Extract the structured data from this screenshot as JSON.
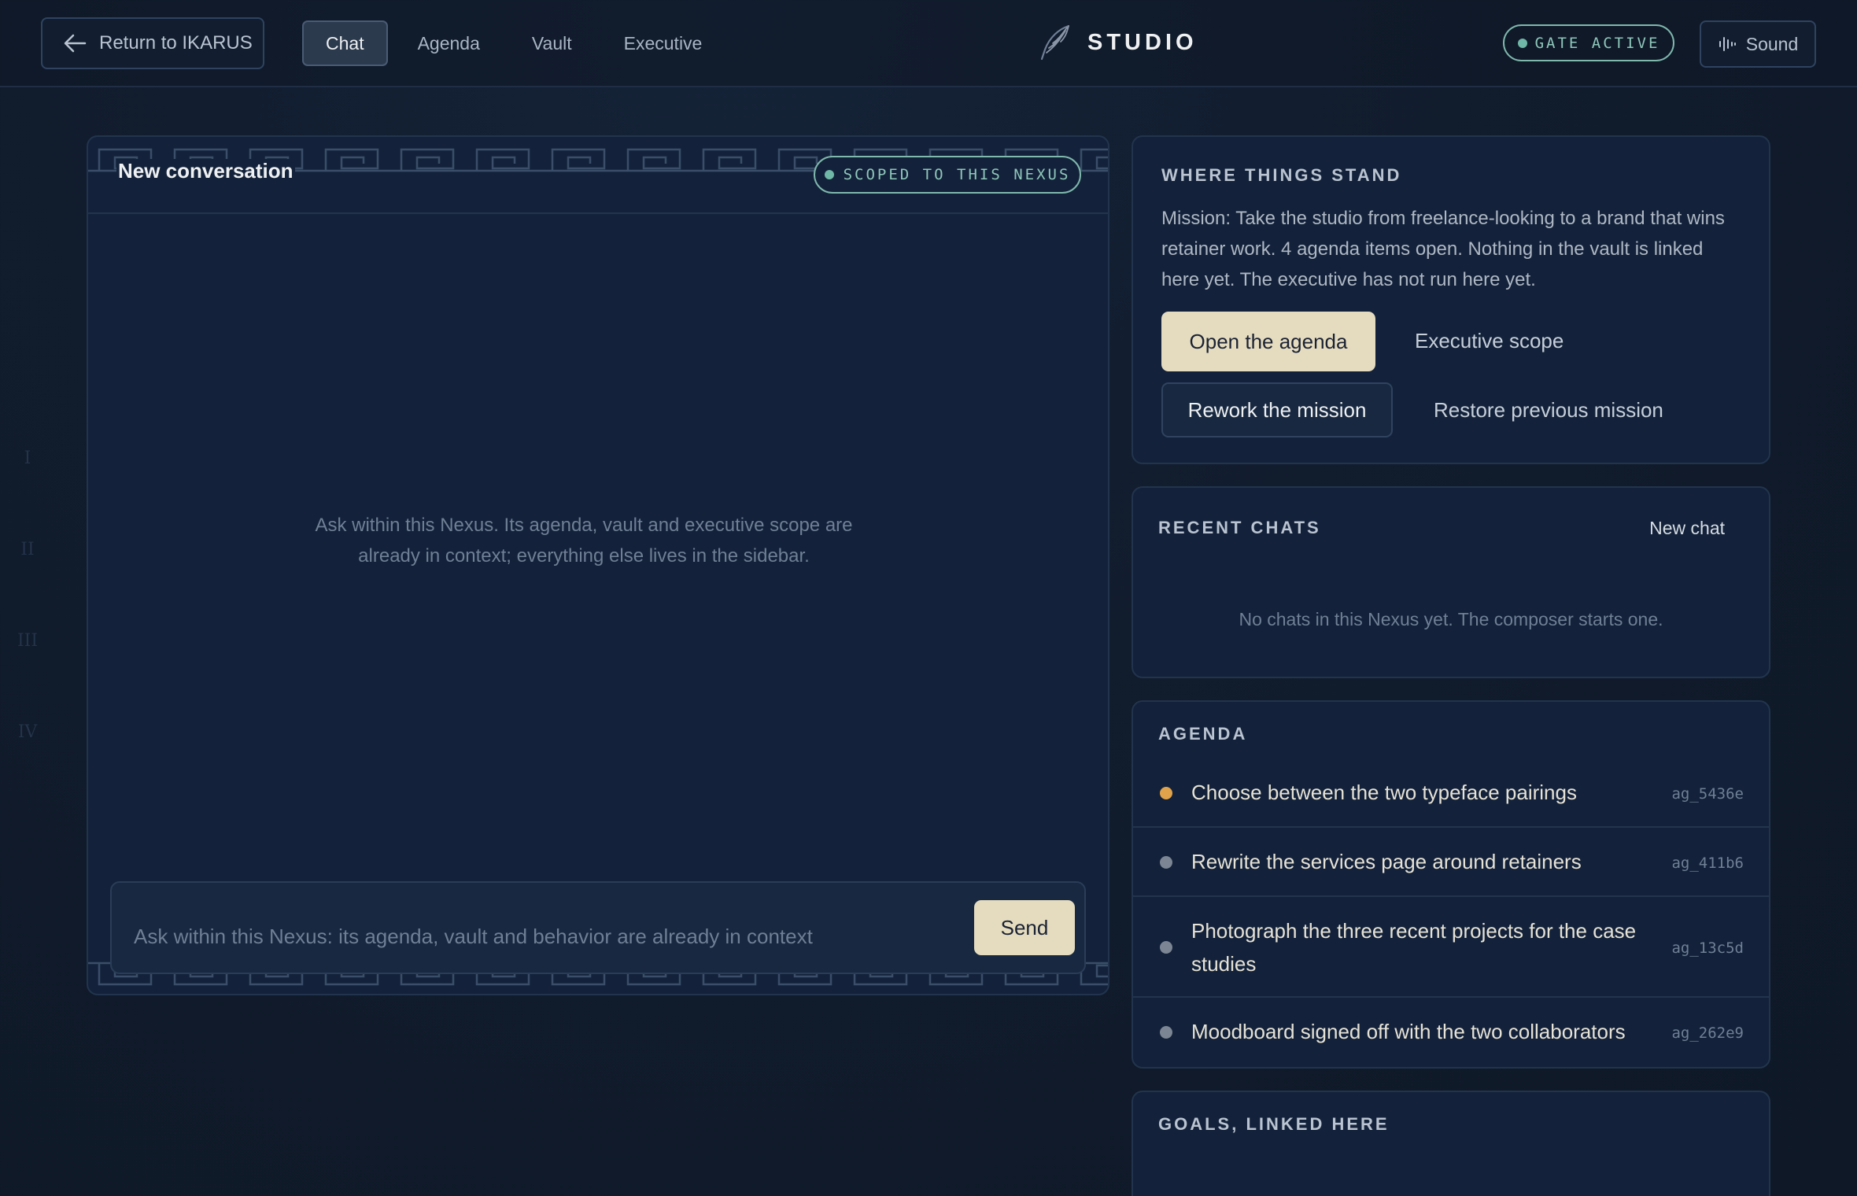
{
  "topbar": {
    "return_label": "Return to IKARUS",
    "tabs": [
      {
        "label": "Chat",
        "active": true
      },
      {
        "label": "Agenda",
        "active": false
      },
      {
        "label": "Vault",
        "active": false
      },
      {
        "label": "Executive",
        "active": false
      }
    ],
    "brand": "STUDIO",
    "gate_badge": "GATE ACTIVE",
    "sound_label": "Sound"
  },
  "numerals": [
    "I",
    "II",
    "III",
    "IV"
  ],
  "chat": {
    "title": "New conversation",
    "scope_badge": "SCOPED TO THIS NEXUS",
    "empty_state": "Ask within this Nexus. Its agenda, vault and executive scope are already in context; everything else lives in the sidebar.",
    "composer_placeholder": "Ask within this Nexus: its agenda, vault and behavior are already in context",
    "send_label": "Send"
  },
  "status": {
    "heading": "WHERE THINGS STAND",
    "text": "Mission: Take the studio from freelance-looking to a brand that wins retainer work. 4 agenda items open. Nothing in the vault is linked here yet. The executive has not run here yet.",
    "open_agenda": "Open the agenda",
    "executive_scope": "Executive scope",
    "rework_mission": "Rework the mission",
    "restore_mission": "Restore previous mission"
  },
  "recent_chats": {
    "heading": "RECENT CHATS",
    "new_chat": "New chat",
    "empty": "No chats in this Nexus yet. The composer starts one."
  },
  "agenda": {
    "heading": "AGENDA",
    "items": [
      {
        "text": "Choose between the two typeface pairings",
        "id": "ag_5436e",
        "status_color": "#e0a24a"
      },
      {
        "text": "Rewrite the services page around retainers",
        "id": "ag_411b6",
        "status_color": "#7b8594"
      },
      {
        "text": "Photograph the three recent projects for the case studies",
        "id": "ag_13c5d",
        "status_color": "#7b8594"
      },
      {
        "text": "Moodboard signed off with the two collaborators",
        "id": "ag_262e9",
        "status_color": "#7b8594"
      }
    ]
  },
  "goals": {
    "heading": "GOALS, LINKED HERE"
  },
  "colors": {
    "accent_cream": "#e5dcc0",
    "accent_teal": "#8fc7bb",
    "background": "#111c2d",
    "panel": "#13223a"
  }
}
